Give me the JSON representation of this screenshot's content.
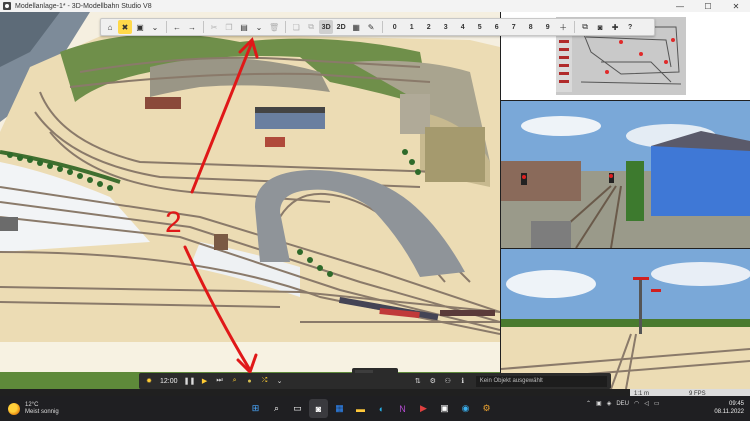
{
  "window": {
    "title": "Modellanlage-1* - 3D-Modellbahn Studio V8",
    "minimize": "—",
    "maximize": "☐",
    "close": "✕"
  },
  "toolbar": {
    "mode_3d": "3D",
    "mode_2d": "2D",
    "layers": [
      "0",
      "1",
      "2",
      "3",
      "4",
      "5",
      "6",
      "7",
      "8",
      "9"
    ],
    "help": "?"
  },
  "viewport": {
    "annotation": "2"
  },
  "bottombar": {
    "time": "12:00",
    "status": "Kein Objekt ausgewählt"
  },
  "cam2": {
    "scale": "1:1 m",
    "fps": "9 FPS"
  },
  "taskbar": {
    "temperature": "12°C",
    "weather": "Meist sonnig",
    "language": "DEU",
    "time": "09:45",
    "date": "08.11.2022"
  },
  "colors": {
    "toolbar_active": "#ffd94a",
    "annotation_red": "#e01818",
    "sand": "#ecdcb4",
    "track": "#8a7a6a",
    "sky": "#7aa8d8"
  }
}
